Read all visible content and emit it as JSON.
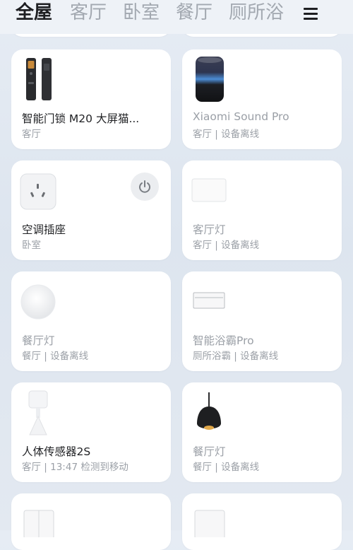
{
  "tabs": [
    "全屋",
    "客厅",
    "卧室",
    "餐厅",
    "厕所浴"
  ],
  "menu_icon": "hamburger-menu-icon",
  "devices": [
    {
      "name": "智能门锁 M20 大屏猫...",
      "status": "客厅",
      "icon": "door-lock-icon",
      "online": true
    },
    {
      "name": "Xiaomi Sound Pro",
      "status": "客厅 | 设备离线",
      "icon": "smart-speaker-icon",
      "online": false
    },
    {
      "name": "空调插座",
      "status": "卧室",
      "icon": "smart-plug-icon",
      "online": true,
      "has_power_button": true
    },
    {
      "name": "客厅灯",
      "status": "客厅 | 设备离线",
      "icon": "ceiling-panel-light-icon",
      "online": false
    },
    {
      "name": "餐厅灯",
      "status": "餐厅 | 设备离线",
      "icon": "round-ceiling-light-icon",
      "online": false
    },
    {
      "name": "智能浴霸Pro",
      "status": "厕所浴霸 | 设备离线",
      "icon": "bath-heater-icon",
      "online": false
    },
    {
      "name": "人体传感器2S",
      "status": "客厅 | 13:47 检测到移动",
      "icon": "motion-sensor-icon",
      "online": true
    },
    {
      "name": "餐厅灯",
      "status": "餐厅 | 设备离线",
      "icon": "pendant-lamp-icon",
      "online": false
    },
    {
      "name": "",
      "status": "",
      "icon": "wall-switch-icon"
    },
    {
      "name": "",
      "status": "",
      "icon": "wall-switch-icon"
    }
  ]
}
